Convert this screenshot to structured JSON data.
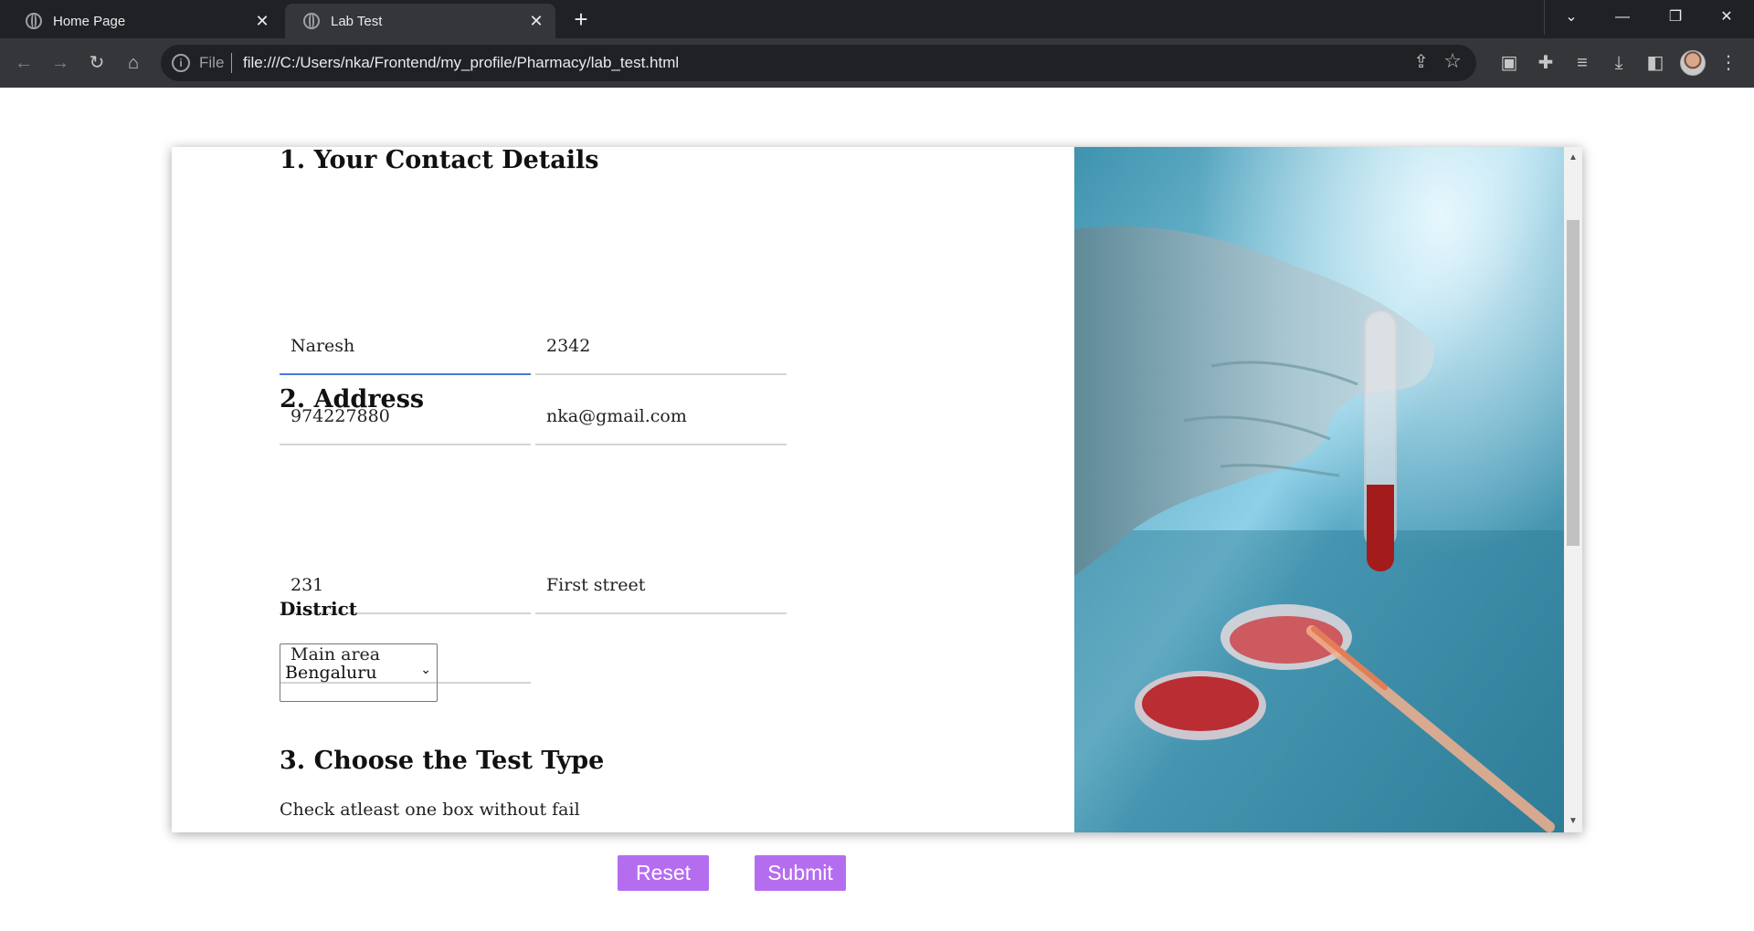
{
  "browser": {
    "tabs": [
      {
        "title": "Home Page",
        "active": false
      },
      {
        "title": "Lab Test",
        "active": true
      }
    ],
    "address": {
      "scheme": "File",
      "url": "file:///C:/Users/nka/Frontend/my_profile/Pharmacy/lab_test.html"
    }
  },
  "form": {
    "contact": {
      "title": "1. Your Contact Details",
      "first_name": "Naresh",
      "id_number": "2342",
      "phone": "974227880",
      "email": "nka@gmail.com"
    },
    "address": {
      "title": "2. Address",
      "house_no": "231",
      "street": "First street",
      "area": "Main area",
      "district_label": "District",
      "district_selected": "Bengaluru"
    },
    "test_type": {
      "title": "3. Choose the Test Type",
      "hint": "Check atleast one box without fail"
    }
  },
  "actions": {
    "reset_label": "Reset",
    "submit_label": "Submit"
  },
  "colors": {
    "button": "#b56df0",
    "focus_underline": "#4a78d6",
    "chrome_dark": "#202124",
    "chrome_toolbar": "#35363a"
  }
}
